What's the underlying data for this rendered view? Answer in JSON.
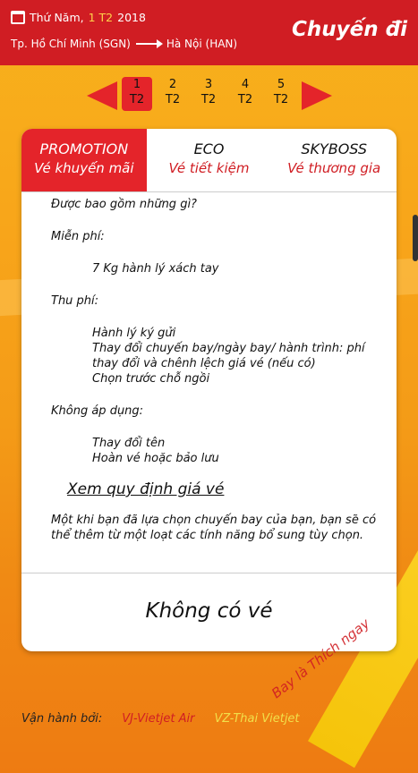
{
  "header": {
    "date_prefix": "Thứ Năm,",
    "date_highlight": "1 T2",
    "year": "2018",
    "origin": "Tp. Hồ Chí Minh (SGN)",
    "destination": "Hà Nội (HAN)",
    "title": "Chuyến đi"
  },
  "day_nav": {
    "days": [
      {
        "num": "1",
        "month": "T2",
        "active": true
      },
      {
        "num": "2",
        "month": "T2"
      },
      {
        "num": "3",
        "month": "T2"
      },
      {
        "num": "4",
        "month": "T2"
      },
      {
        "num": "5",
        "month": "T2"
      }
    ]
  },
  "tabs": [
    {
      "name": "PROMOTION",
      "sub": "Vé khuyến mãi",
      "active": true
    },
    {
      "name": "ECO",
      "sub": "Vé tiết kiệm"
    },
    {
      "name": "SKYBOSS",
      "sub": "Vé thương gia"
    }
  ],
  "content": {
    "included": "Được bao gồm những gì?",
    "free_label": "Miễn phí:",
    "free_items": [
      "7 Kg hành lý xách tay"
    ],
    "fee_label": "Thu phí:",
    "fee_items": [
      "Hành lý ký gửi",
      "Thay đổi chuyến bay/ngày bay/ hành trình: phí thay đổi và chênh lệch giá vé (nếu có)",
      "Chọn trước chỗ ngồi"
    ],
    "na_label": "Không áp dụng:",
    "na_items": [
      "Thay đổi tên",
      "Hoàn vé hoặc bảo lưu"
    ],
    "link": "Xem quy định giá vé",
    "note": "Một khi bạn đã lựa chọn chuyến bay của bạn, bạn sẽ có thể thêm từ một loạt các tính năng bổ sung tùy chọn."
  },
  "no_ticket": "Không có vé",
  "footer": {
    "label": "Vận hành bởi:",
    "airline1": "VJ-Vietjet Air",
    "airline2": "VZ-Thai Vietjet"
  },
  "watermark": "Bay là Thích ngay",
  "colors": {
    "brand_red": "#d01d23",
    "accent_red": "#e4242a",
    "background": "#f7b21c"
  }
}
